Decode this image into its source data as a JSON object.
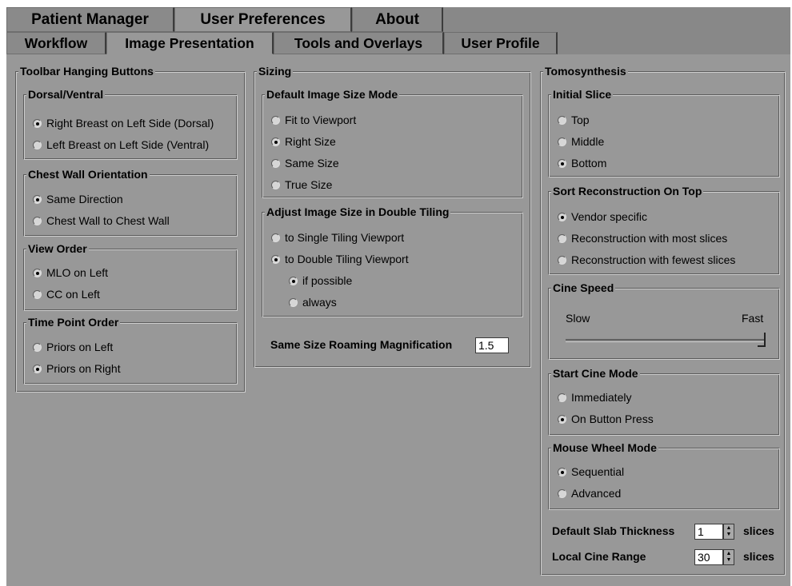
{
  "tabs": [
    "Patient Manager",
    "User Preferences",
    "About"
  ],
  "subtabs": [
    "Workflow",
    "Image Presentation",
    "Tools and Overlays",
    "User Profile"
  ],
  "toolbar": {
    "title": "Toolbar Hanging Buttons",
    "dorsal": {
      "title": "Dorsal/Ventral",
      "options": [
        "Right Breast on Left Side (Dorsal)",
        "Left Breast on Left Side (Ventral)"
      ]
    },
    "chest": {
      "title": "Chest Wall Orientation",
      "options": [
        "Same Direction",
        "Chest Wall to Chest Wall"
      ]
    },
    "view": {
      "title": "View Order",
      "options": [
        "MLO on Left",
        "CC on Left"
      ]
    },
    "time": {
      "title": "Time Point Order",
      "options": [
        "Priors on Left",
        "Priors on Right"
      ]
    }
  },
  "sizing": {
    "title": "Sizing",
    "mode": {
      "title": "Default Image Size Mode",
      "options": [
        "Fit to Viewport",
        "Right Size",
        "Same Size",
        "True Size"
      ]
    },
    "double": {
      "title": "Adjust Image Size in Double Tiling",
      "options": [
        "to Single Tiling Viewport",
        "to Double Tiling Viewport"
      ],
      "sub_options": [
        "if possible",
        "always"
      ]
    },
    "roaming": {
      "label": "Same Size Roaming Magnification",
      "value": "1.5"
    }
  },
  "tomo": {
    "title": "Tomosynthesis",
    "initial": {
      "title": "Initial Slice",
      "options": [
        "Top",
        "Middle",
        "Bottom"
      ]
    },
    "sort": {
      "title": "Sort Reconstruction On Top",
      "options": [
        "Vendor specific",
        "Reconstruction with most slices",
        "Reconstruction with fewest slices"
      ]
    },
    "cine": {
      "title": "Cine Speed",
      "slow": "Slow",
      "fast": "Fast",
      "speed": 1.0
    },
    "start": {
      "title": "Start Cine Mode",
      "options": [
        "Immediately",
        "On Button Press"
      ]
    },
    "wheel": {
      "title": "Mouse Wheel Mode",
      "options": [
        "Sequential",
        "Advanced"
      ]
    },
    "slab": {
      "label": "Default Slab Thickness",
      "value": "1",
      "unit": "slices"
    },
    "range": {
      "label": "Local Cine Range",
      "value": "30",
      "unit": "slices"
    }
  }
}
